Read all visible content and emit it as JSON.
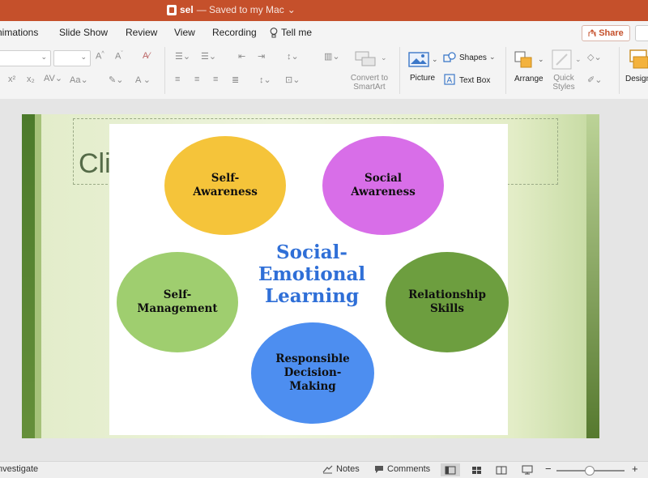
{
  "window": {
    "doc_name": "sel",
    "save_status": "— Saved to my Mac",
    "chevron": "⌄"
  },
  "tabs": [
    "nimations",
    "Slide Show",
    "Review",
    "View",
    "Recording",
    "Tell me"
  ],
  "share_label": "Share",
  "ribbon": {
    "convert_smartart": [
      "Convert to",
      "SmartArt"
    ],
    "picture": "Picture",
    "shapes": "Shapes",
    "text_box": "Text Box",
    "arrange": "Arrange",
    "quick_styles": [
      "Quick",
      "Styles"
    ],
    "design": "Design"
  },
  "slide": {
    "placeholder_text": "Cli",
    "center_title": [
      "Social-",
      "Emotional",
      "Learning"
    ],
    "circles": [
      {
        "lines": [
          "Self-",
          "Awareness"
        ],
        "color": "#f5c43a"
      },
      {
        "lines": [
          "Social",
          "Awareness"
        ],
        "color": "#d86ee8"
      },
      {
        "lines": [
          "Self-",
          "Management"
        ],
        "color": "#9fce6f"
      },
      {
        "lines": [
          "Relationship",
          "Skills"
        ],
        "color": "#6d9e3f"
      },
      {
        "lines": [
          "Responsible",
          "Decision-",
          "Making"
        ],
        "color": "#4d8ef0"
      }
    ]
  },
  "status": {
    "left": "nvestigate",
    "notes": "Notes",
    "comments": "Comments",
    "zoom_minus": "−",
    "zoom_plus": "+"
  }
}
